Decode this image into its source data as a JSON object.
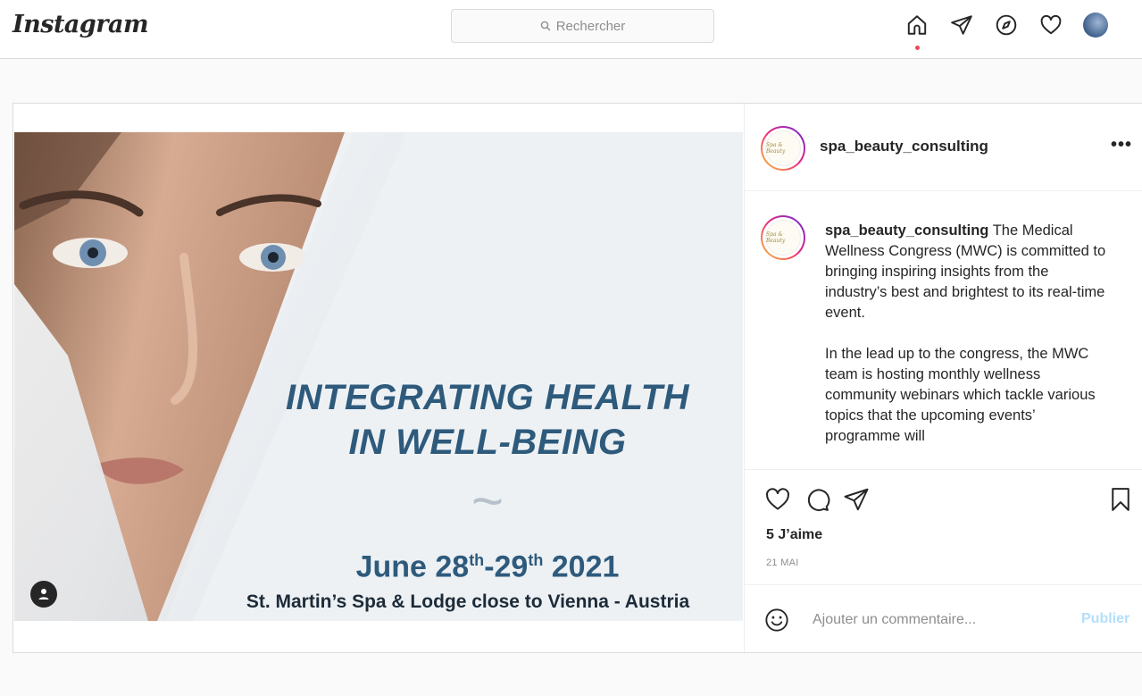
{
  "nav": {
    "logo": "Instagram",
    "search_placeholder": "Rechercher",
    "icons": [
      "home-icon",
      "direct-icon",
      "explore-icon",
      "activity-heart-icon",
      "profile-avatar"
    ],
    "notification_dot_color": "#ed4956"
  },
  "post": {
    "image": {
      "headline_line1": "INTEGRATING HEALTH",
      "headline_line2": "IN WELL-BEING",
      "tilde": "~",
      "date_prefix": "June 28",
      "date_sup1": "th",
      "date_mid": "-29",
      "date_sup2": "th",
      "date_suffix": " 2021",
      "place": "St. Martin’s Spa & Lodge close to Vienna - Austria",
      "accent_color": "#2e5a7c"
    },
    "author": {
      "username": "spa_beauty_consulting",
      "avatar_text": "Spa & Beauty"
    },
    "more_label": "•••",
    "caption": {
      "username": "spa_beauty_consulting",
      "paragraph1": "The Medical Wellness Congress (MWC) is committed to bringing inspiring insights from the industry’s best and brightest to its real-time event.",
      "paragraph2": "In the lead up to the congress, the MWC team is hosting monthly wellness community webinars which tackle various topics that the upcoming events’ programme will"
    },
    "likes": "5 J’aime",
    "date": "21 MAI",
    "comment": {
      "placeholder": "Ajouter un commentaire...",
      "publish_label": "Publier",
      "publish_color": "#b2dffc"
    }
  }
}
